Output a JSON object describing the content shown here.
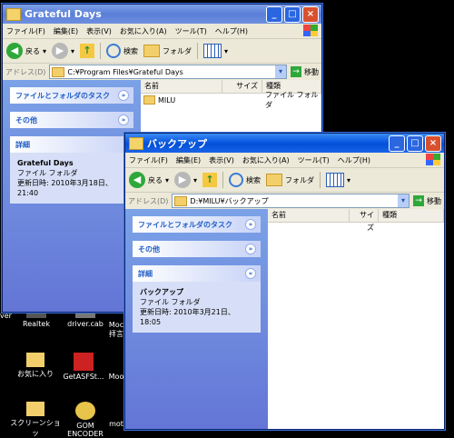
{
  "desktop": {
    "icons": [
      {
        "label": "ver"
      },
      {
        "label": "Realtek"
      },
      {
        "label": "driver.cab"
      },
      {
        "label": "Moc"
      },
      {
        "label": "拝言"
      },
      {
        "label": "お気に入り"
      },
      {
        "label": "GetASFSt..."
      },
      {
        "label": "Moo"
      },
      {
        "label": "スクリーンショッ"
      },
      {
        "label": "GOM"
      },
      {
        "label": "ENCODER"
      },
      {
        "label": "mot"
      }
    ]
  },
  "window1": {
    "title": "Grateful Days",
    "menu": [
      "ファイル(F)",
      "編集(E)",
      "表示(V)",
      "お気に入り(A)",
      "ツール(T)",
      "ヘルプ(H)"
    ],
    "toolbar": {
      "back": "戻る",
      "search": "検索",
      "folders": "フォルダ"
    },
    "address_label": "アドレス(D)",
    "address": "C:¥Program Files¥Grateful Days",
    "go": "移動",
    "panels": {
      "tasks": "ファイルとフォルダのタスク",
      "other": "その他",
      "details": "詳細"
    },
    "details": {
      "name": "Grateful Days",
      "type": "ファイル フォルダ",
      "modified": "更新日時: 2010年3月18日、21:40"
    },
    "columns": [
      "名前",
      "サイズ",
      "種類"
    ],
    "files": [
      {
        "name": "MILU",
        "size": "",
        "type": "ファイル フォルダ"
      }
    ]
  },
  "window2": {
    "title": "バックアップ",
    "menu": [
      "ファイル(F)",
      "編集(E)",
      "表示(V)",
      "お気に入り(A)",
      "ツール(T)",
      "ヘルプ(H)"
    ],
    "toolbar": {
      "back": "戻る",
      "search": "検索",
      "folders": "フォルダ"
    },
    "address_label": "アドレス(D)",
    "address": "D:¥MILU¥バックアップ",
    "go": "移動",
    "panels": {
      "tasks": "ファイルとフォルダのタスク",
      "other": "その他",
      "details": "詳細"
    },
    "details": {
      "name": "バックアップ",
      "type": "ファイル フォルダ",
      "modified": "更新日時: 2010年3月21日、18:05"
    },
    "columns": [
      "名前",
      "サイズ",
      "種類"
    ]
  }
}
